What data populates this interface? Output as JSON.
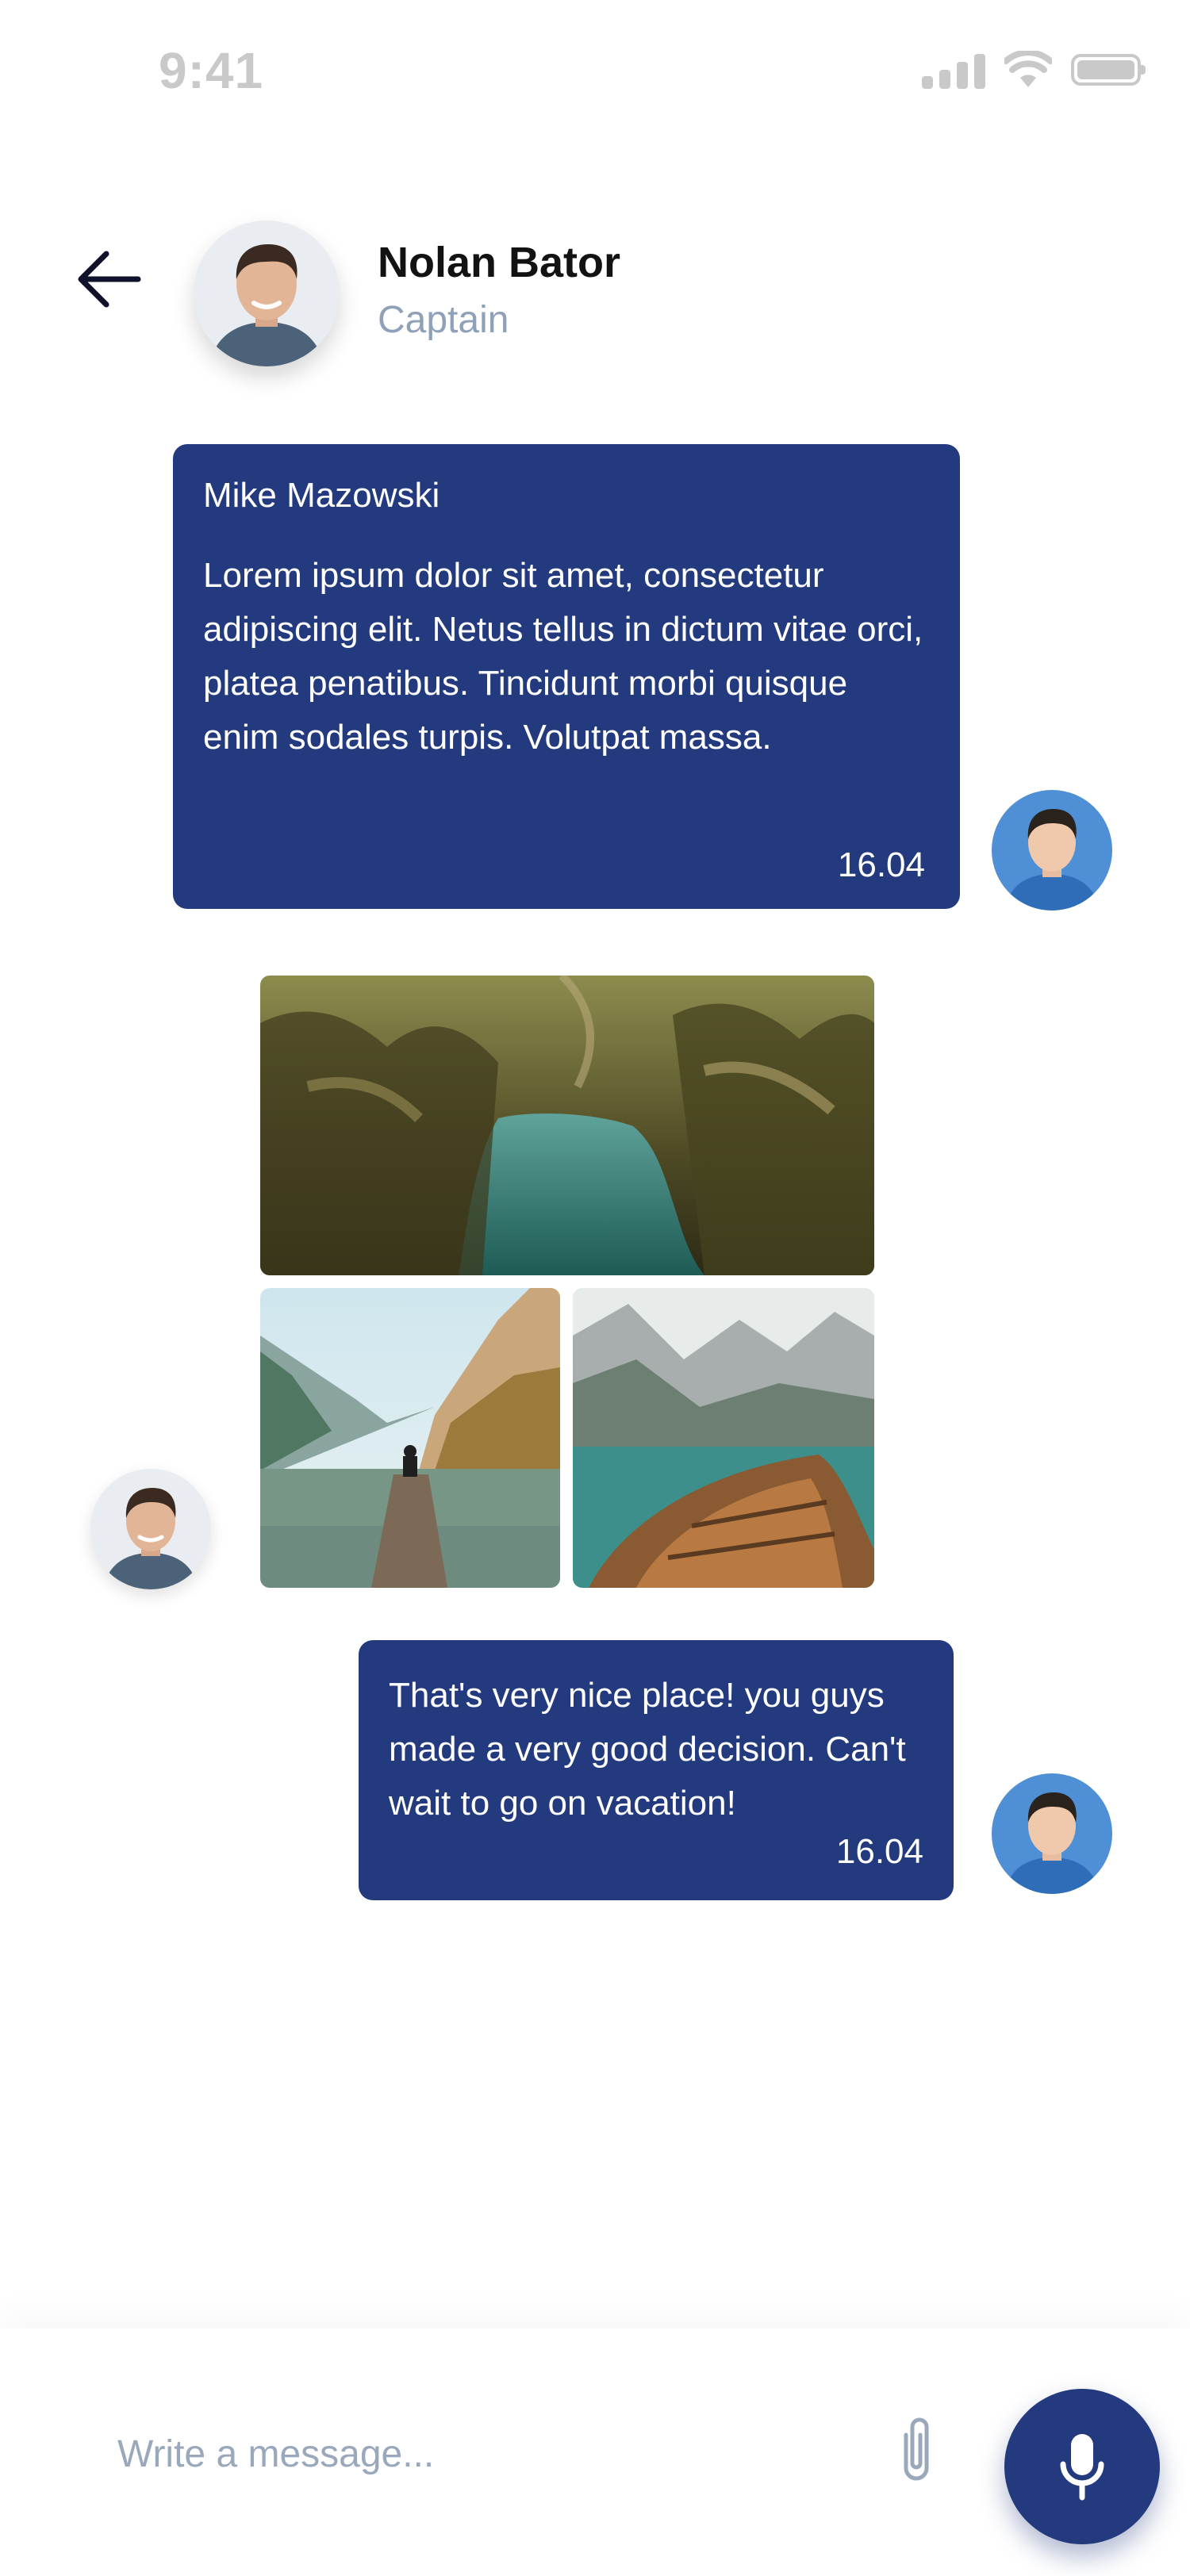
{
  "status_bar": {
    "time": "9:41"
  },
  "header": {
    "name": "Nolan Bator",
    "role": "Captain"
  },
  "messages": [
    {
      "sender": "Mike Mazowski",
      "text": "Lorem ipsum dolor sit amet, consectetur adipiscing elit. Netus tellus in dictum vitae orci, platea penatibus. Tincidunt morbi quisque enim sodales turpis. Volutpat massa.",
      "time": "16.04"
    },
    {
      "text": "That's very nice place! you guys made a very good decision. Can't wait to go on vacation!",
      "time": "16.04"
    }
  ],
  "composer": {
    "placeholder": "Write a message..."
  },
  "colors": {
    "accent": "#233a7e",
    "role_text": "#8fa1b8",
    "status_gray": "#c9c9c9"
  },
  "icons": [
    "back-arrow-icon",
    "signal-icon",
    "wifi-icon",
    "battery-icon",
    "paperclip-icon",
    "microphone-icon"
  ]
}
